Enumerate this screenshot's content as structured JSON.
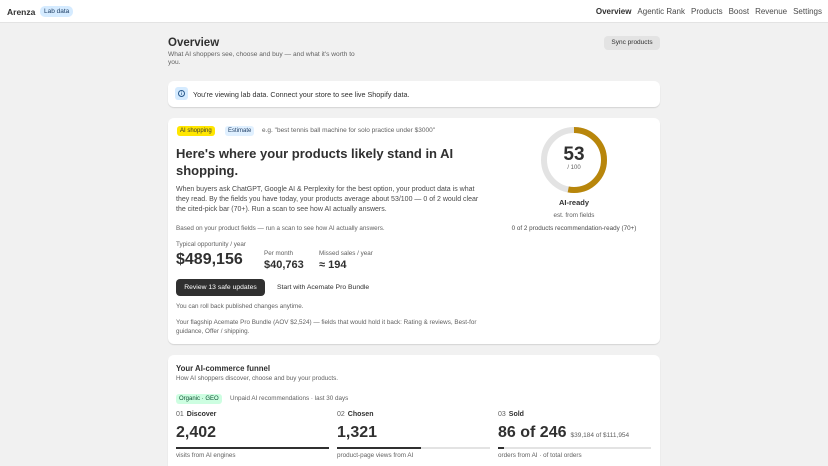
{
  "header": {
    "brand": "Arenza",
    "lab_badge": "Lab data",
    "nav": [
      "Overview",
      "Agentic Rank",
      "Products",
      "Boost",
      "Revenue",
      "Settings"
    ],
    "active_nav": "Overview"
  },
  "page": {
    "title": "Overview",
    "subtitle": "What AI shoppers see, choose and buy — and what it's worth to you.",
    "sync_button": "Sync products"
  },
  "banner": {
    "icon": "info-icon",
    "text": "You're viewing lab data. Connect your store to see live Shopify data."
  },
  "main_card": {
    "badge_ai": "AI shopping",
    "badge_estimate": "Estimate",
    "example": "e.g. \"best tennis ball machine for solo practice under $3000\"",
    "headline": "Here's where your products likely stand in AI shopping.",
    "body": "When buyers ask ChatGPT, Google AI & Perplexity for the best option, your product data is what they read. By the fields you have today, your products average about 53/100 — 0 of 2 would clear the cited-pick bar (70+). Run a scan to see how AI actually answers.",
    "note": "Based on your product fields — run a scan to see how AI actually answers.",
    "opportunity_label": "Typical opportunity / year",
    "opportunity_value": "$489,156",
    "per_month_label": "Per month",
    "per_month_value": "$40,763",
    "missed_label": "Missed sales / year",
    "missed_value": "≈ 194",
    "primary_button": "Review 13 safe updates",
    "secondary_button": "Start with Acemate Pro Bundle",
    "rollback": "You can roll back published changes anytime.",
    "flagship": "Your flagship Acemate Pro Bundle (AOV $2,524) — fields that would hold it back: Rating & reviews, Best-for guidance, Offer / shipping.",
    "score": {
      "value": "53",
      "max_label": "/ 100",
      "fraction": 0.53,
      "status": "AI-ready",
      "est": "est. from fields",
      "products_ready": "0 of 2 products recommendation-ready (70+)",
      "ring_color": "#b8860b",
      "track_color": "#e3e3e3"
    }
  },
  "funnel": {
    "title": "Your AI-commerce funnel",
    "subtitle": "How AI shoppers discover, choose and buy your products.",
    "badge": "Organic · GEO",
    "meta": "Unpaid AI recommendations · last 30 days",
    "stages": [
      {
        "num": "01",
        "name": "Discover",
        "value": "2,402",
        "value_sub": "",
        "fill": 1.0,
        "caption": "visits from AI engines"
      },
      {
        "num": "02",
        "name": "Chosen",
        "value": "1,321",
        "value_sub": "",
        "fill": 0.55,
        "caption": "product-page views from AI"
      },
      {
        "num": "03",
        "name": "Sold",
        "value": "86 of 246",
        "value_sub": "$39,184 of $111,954",
        "fill": 0.04,
        "caption": "orders from AI · of total orders"
      }
    ]
  }
}
